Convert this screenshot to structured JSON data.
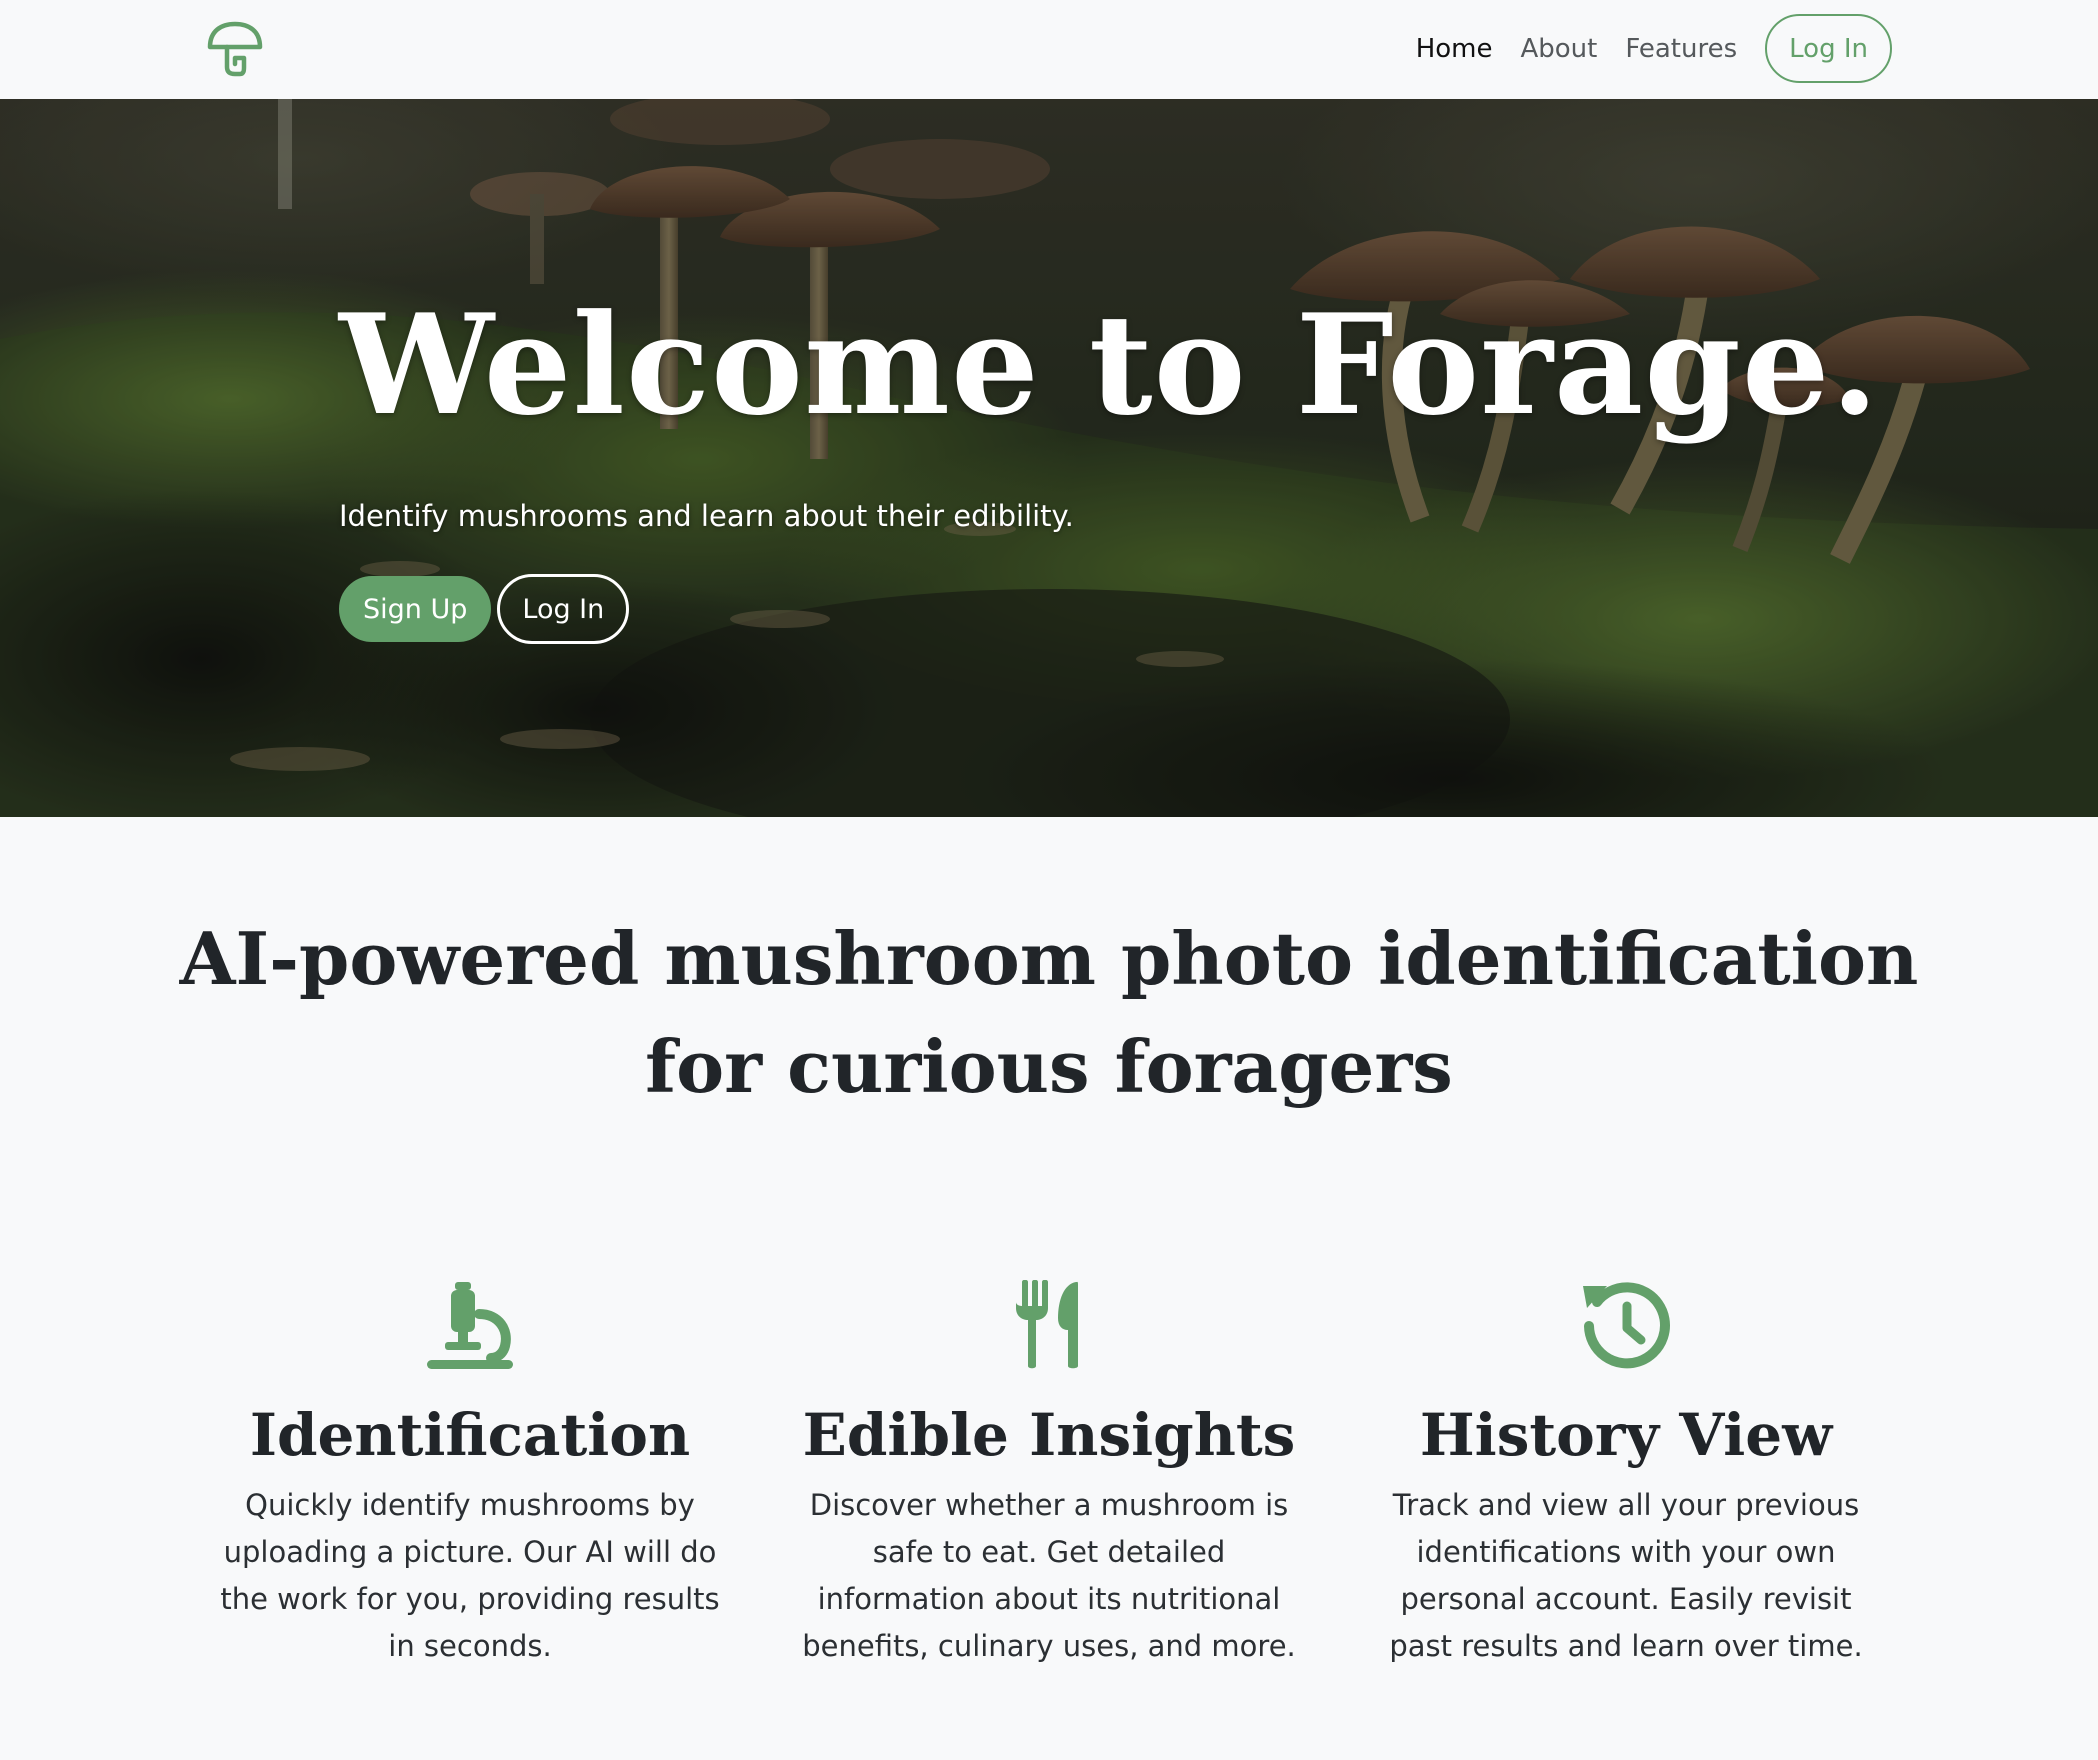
{
  "nav": {
    "brand_icon": "mushroom-icon",
    "links": [
      "Home",
      "About",
      "Features"
    ],
    "login_label": "Log In"
  },
  "hero": {
    "title": "Welcome to Forage.",
    "subtitle": "Identify mushrooms and learn about their edibility.",
    "signup_label": "Sign Up",
    "login_label": "Log In"
  },
  "section": {
    "title": "AI-powered mushroom photo identification for curious foragers"
  },
  "features": [
    {
      "icon": "microscope-icon",
      "title": "Identification",
      "text": "Quickly identify mushrooms by uploading a picture. Our AI will do the work for you, providing results in seconds."
    },
    {
      "icon": "utensils-icon",
      "title": "Edible Insights",
      "text": "Discover whether a mushroom is safe to eat. Get detailed information about its nutritional benefits, culinary uses, and more."
    },
    {
      "icon": "history-icon",
      "title": "History View",
      "text": "Track and view all your previous identifications with your own personal account. Easily revisit past results and learn over time."
    }
  ],
  "colors": {
    "accent": "#63a06a",
    "page_background": "#f8f9fa",
    "heading": "#212529"
  }
}
